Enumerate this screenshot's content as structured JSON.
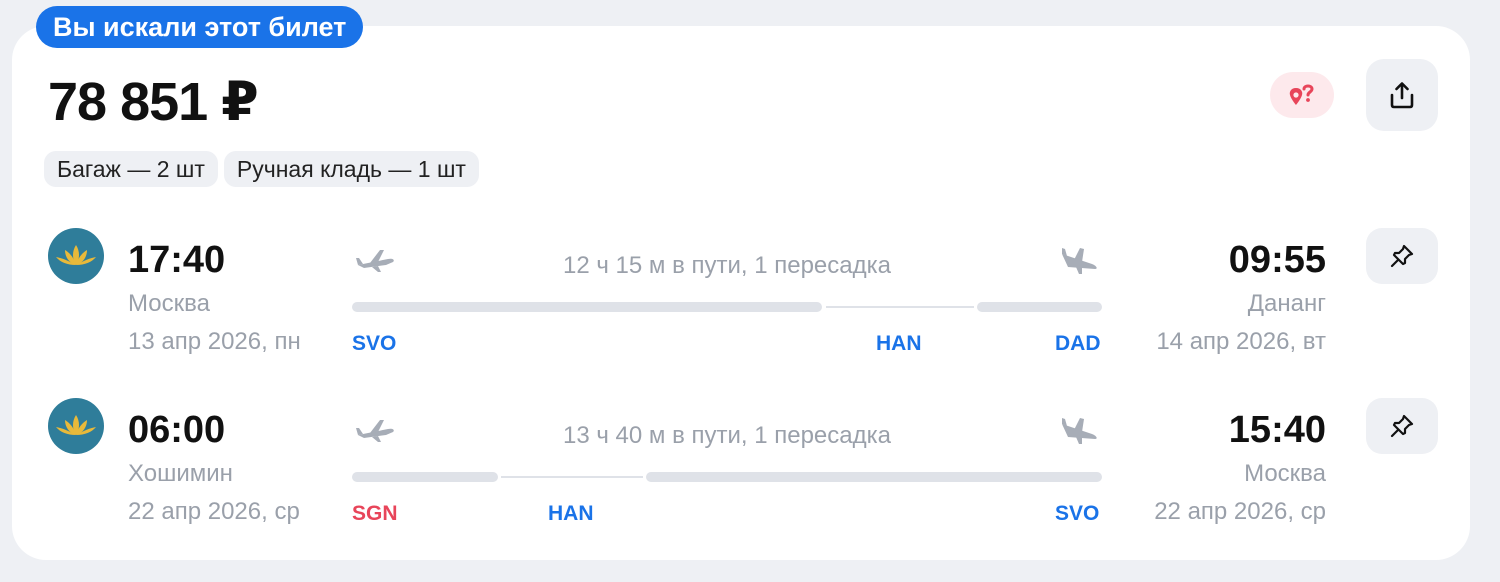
{
  "banner": {
    "label": "Вы искали этот билет"
  },
  "price": "78 851 ₽",
  "baggage": [
    {
      "label": "Багаж — 2 шт"
    },
    {
      "label": "Ручная кладь — 1 шт"
    }
  ],
  "icons": {
    "geo": "map-pin-question-icon",
    "share": "share-icon",
    "pin": "pin-icon",
    "plane_takeoff": "plane-takeoff-icon",
    "plane_landing": "plane-landing-icon",
    "airline_logo": "airline-lotus-logo"
  },
  "colors": {
    "accent": "#1a73e8",
    "alert": "#e8455a",
    "muted": "#9aa0aa",
    "surface": "#eef0f4"
  },
  "segments": [
    {
      "departure": {
        "time": "17:40",
        "city": "Москва",
        "date": "13 апр 2026, пн"
      },
      "arrival": {
        "time": "09:55",
        "city": "Дананг",
        "date": "14 апр 2026, вт"
      },
      "duration": "12 ч 15 м в пути, 1 пересадка",
      "codes": {
        "origin": "SVO",
        "transfer": "HAN",
        "destination": "DAD"
      }
    },
    {
      "departure": {
        "time": "06:00",
        "city": "Хошимин",
        "date": "22 апр 2026, ср"
      },
      "arrival": {
        "time": "15:40",
        "city": "Москва",
        "date": "22 апр 2026, ср"
      },
      "duration": "13 ч 40 м в пути, 1 пересадка",
      "codes": {
        "origin": "SGN",
        "transfer": "HAN",
        "destination": "SVO"
      }
    }
  ]
}
